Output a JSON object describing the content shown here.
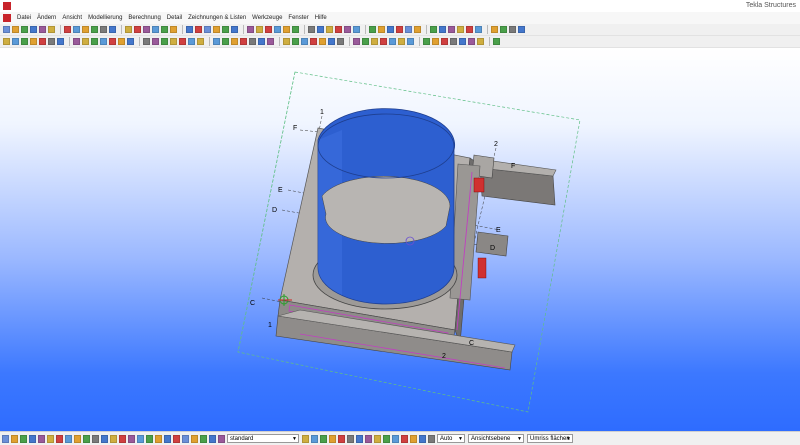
{
  "window": {
    "title": "Tekla Structures"
  },
  "menu": {
    "items": [
      "Datei",
      "Ändern",
      "Ansicht",
      "Modellierung",
      "Berechnung",
      "Detail",
      "Zeichnungen & Listen",
      "Werkzeuge",
      "Fenster",
      "Hilfe"
    ]
  },
  "toolbar1": {
    "colors": [
      "#6a8fd8",
      "#e0a030",
      "#4aa04a",
      "#4477cc",
      "#9a5a9a",
      "#cfae40",
      "#d04040",
      "#5a9ad8",
      "#e0a030",
      "#4aa04a",
      "#7a7a7a",
      "#4477cc",
      "#cfae40",
      "#d04040",
      "#9a5a9a",
      "#5a9ad8",
      "#4aa04a",
      "#e0a030",
      "#4477cc",
      "#d04040"
    ]
  },
  "toolbar2": {
    "colors": [
      "#cfae40",
      "#5a9ad8",
      "#4aa04a",
      "#e0a030",
      "#d04040",
      "#7a7a7a",
      "#4477cc",
      "#9a5a9a",
      "#cfae40",
      "#4aa04a",
      "#5a9ad8",
      "#d04040",
      "#e0a030",
      "#4477cc",
      "#7a7a7a",
      "#9a5a9a",
      "#4aa04a",
      "#cfae40",
      "#d04040",
      "#5a9ad8"
    ]
  },
  "grid_labels": {
    "top_1": "1",
    "top_f": "F",
    "top_2": "2",
    "right_f": "F",
    "left_e": "E",
    "left_d": "D",
    "left_c": "C",
    "left_1": "1",
    "right_e": "E",
    "right_d": "D",
    "bottom_c": "C",
    "bottom_2": "2"
  },
  "statusbar": {
    "filter_value": "standard",
    "snap_value": "Auto",
    "plane_value": "Ansichtsebene",
    "surface_value": "Umriss flächen"
  }
}
